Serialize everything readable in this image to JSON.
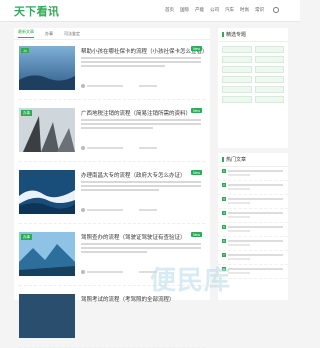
{
  "header": {
    "logo": "天下看讯",
    "nav": [
      "首页",
      "国际",
      "产能",
      "公司",
      "汽车",
      "时尚",
      "常识",
      "..."
    ]
  },
  "tabs": [
    "最新文章",
    "办事",
    "司法鉴定"
  ],
  "articles": [
    {
      "tag": "Jo",
      "title": "帮助小孩在哪社保卡的流程（小孩社保卡怎么查看）",
      "new": "New"
    },
    {
      "tag": "办事",
      "title": "广西地税注销的流程（简易注销所需的资料）",
      "new": "New"
    },
    {
      "tag": "",
      "title": "办理南昌大专的流程（政府大专怎么办证）",
      "new": "New"
    },
    {
      "tag": "办事",
      "title": "驾照查办的流程（驾驶证驾驶证有查验证）",
      "new": "New"
    },
    {
      "tag": "",
      "title": "驾照考试的流程（考驾照的全部流程）",
      "new": ""
    }
  ],
  "sidebar": {
    "card1_title": "精选专题",
    "card2_title": "热门文章"
  },
  "watermark": "便民库"
}
